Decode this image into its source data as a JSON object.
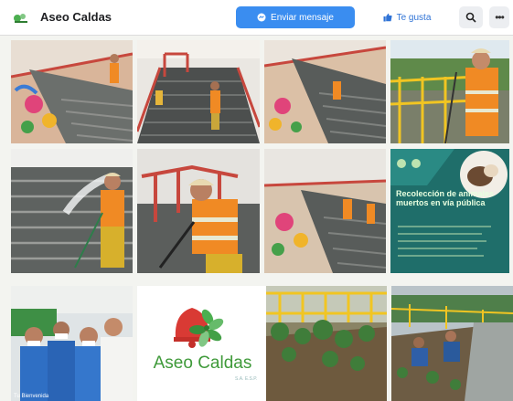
{
  "header": {
    "page_name": "Aseo Caldas",
    "message_label": "Enviar mensaje",
    "like_label": "Te gusta"
  },
  "tiles": {
    "promo_title": "Recolección de animales muertos en vía pública",
    "brand_name": "Aseo Caldas",
    "brand_sub": "S.A. E.S.P.",
    "group_caption": "Tu Bienvenida"
  },
  "colors": {
    "accent": "#3a8df0",
    "brand_green": "#3f9a3a",
    "brand_red": "#d93a34",
    "vest_orange": "#f08a24",
    "promo_teal": "#1f6e6a"
  },
  "icons": [
    "messenger-icon",
    "thumbs-up-icon",
    "search-icon",
    "more-icon"
  ]
}
